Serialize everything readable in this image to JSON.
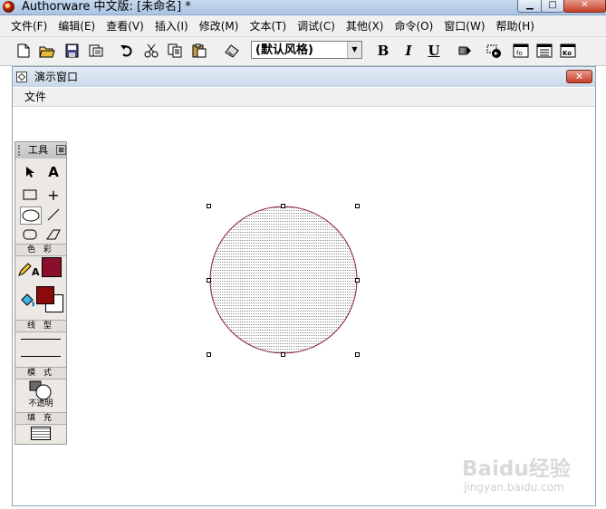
{
  "app": {
    "title": "Authorware 中文版: [未命名] *",
    "min_glyph": "▁",
    "max_glyph": "□",
    "close_glyph": "✕"
  },
  "menubar": {
    "items": [
      "文件(F)",
      "编辑(E)",
      "查看(V)",
      "插入(I)",
      "修改(M)",
      "文本(T)",
      "调试(C)",
      "其他(X)",
      "命令(O)",
      "窗口(W)",
      "帮助(H)"
    ]
  },
  "toolbar": {
    "style_value": "(默认风格)",
    "bold_label": "B",
    "italic_label": "I",
    "underline_label": "U",
    "func_label": "fo",
    "ko_label": "Ko"
  },
  "presentation": {
    "title": "演示窗口",
    "menu_file": "文件",
    "close_glyph": "✕"
  },
  "tools_panel": {
    "title": "工具",
    "close_glyph": "⊠",
    "section_color": "色 彩",
    "section_line": "线 型",
    "section_mode": "模 式",
    "mode_value": "不透明",
    "section_fill": "填 充",
    "stroke_color": "#8b0f2a",
    "fill_fg_color": "#8b0a0a",
    "fill_bg_color": "#ffffff"
  },
  "canvas": {
    "circle_stroke": "#8b1a3a",
    "circle_pattern": "#9a9a9a"
  },
  "watermark": {
    "logo": "Baidu经验",
    "url": "jingyan.baidu.com"
  }
}
